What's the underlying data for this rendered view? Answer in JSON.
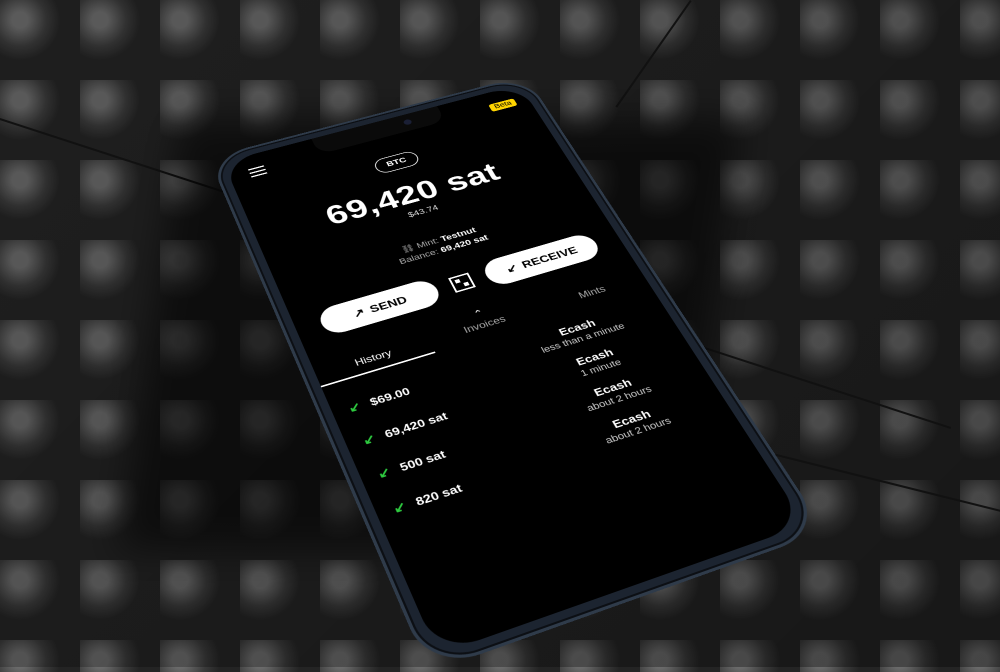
{
  "header": {
    "beta_label": "Beta"
  },
  "wallet": {
    "unit": "BTC",
    "balance": "69,420 sat",
    "fiat": "$43.74",
    "mint_prefix": "Mint:",
    "mint_name": "Testnut",
    "balance_prefix": "Balance:",
    "balance_value": "69,420 sat"
  },
  "actions": {
    "send_label": "SEND",
    "receive_label": "RECEIVE"
  },
  "tabs": [
    {
      "label": "History"
    },
    {
      "label": "Invoices"
    },
    {
      "label": "Mints"
    }
  ],
  "history": [
    {
      "amount": "$69.00"
    },
    {
      "amount": "69,420 sat"
    },
    {
      "amount": "500 sat"
    },
    {
      "amount": "820 sat"
    }
  ],
  "invoices": [
    {
      "title": "Ecash",
      "time": "less than a minute"
    },
    {
      "title": "Ecash",
      "time": "1 minute"
    },
    {
      "title": "Ecash",
      "time": "about 2 hours"
    },
    {
      "title": "Ecash",
      "time": "about 2 hours"
    }
  ],
  "colors": {
    "accent_yellow": "#ffd400",
    "incoming_green": "#2ecc40",
    "screen_bg": "#000000"
  }
}
